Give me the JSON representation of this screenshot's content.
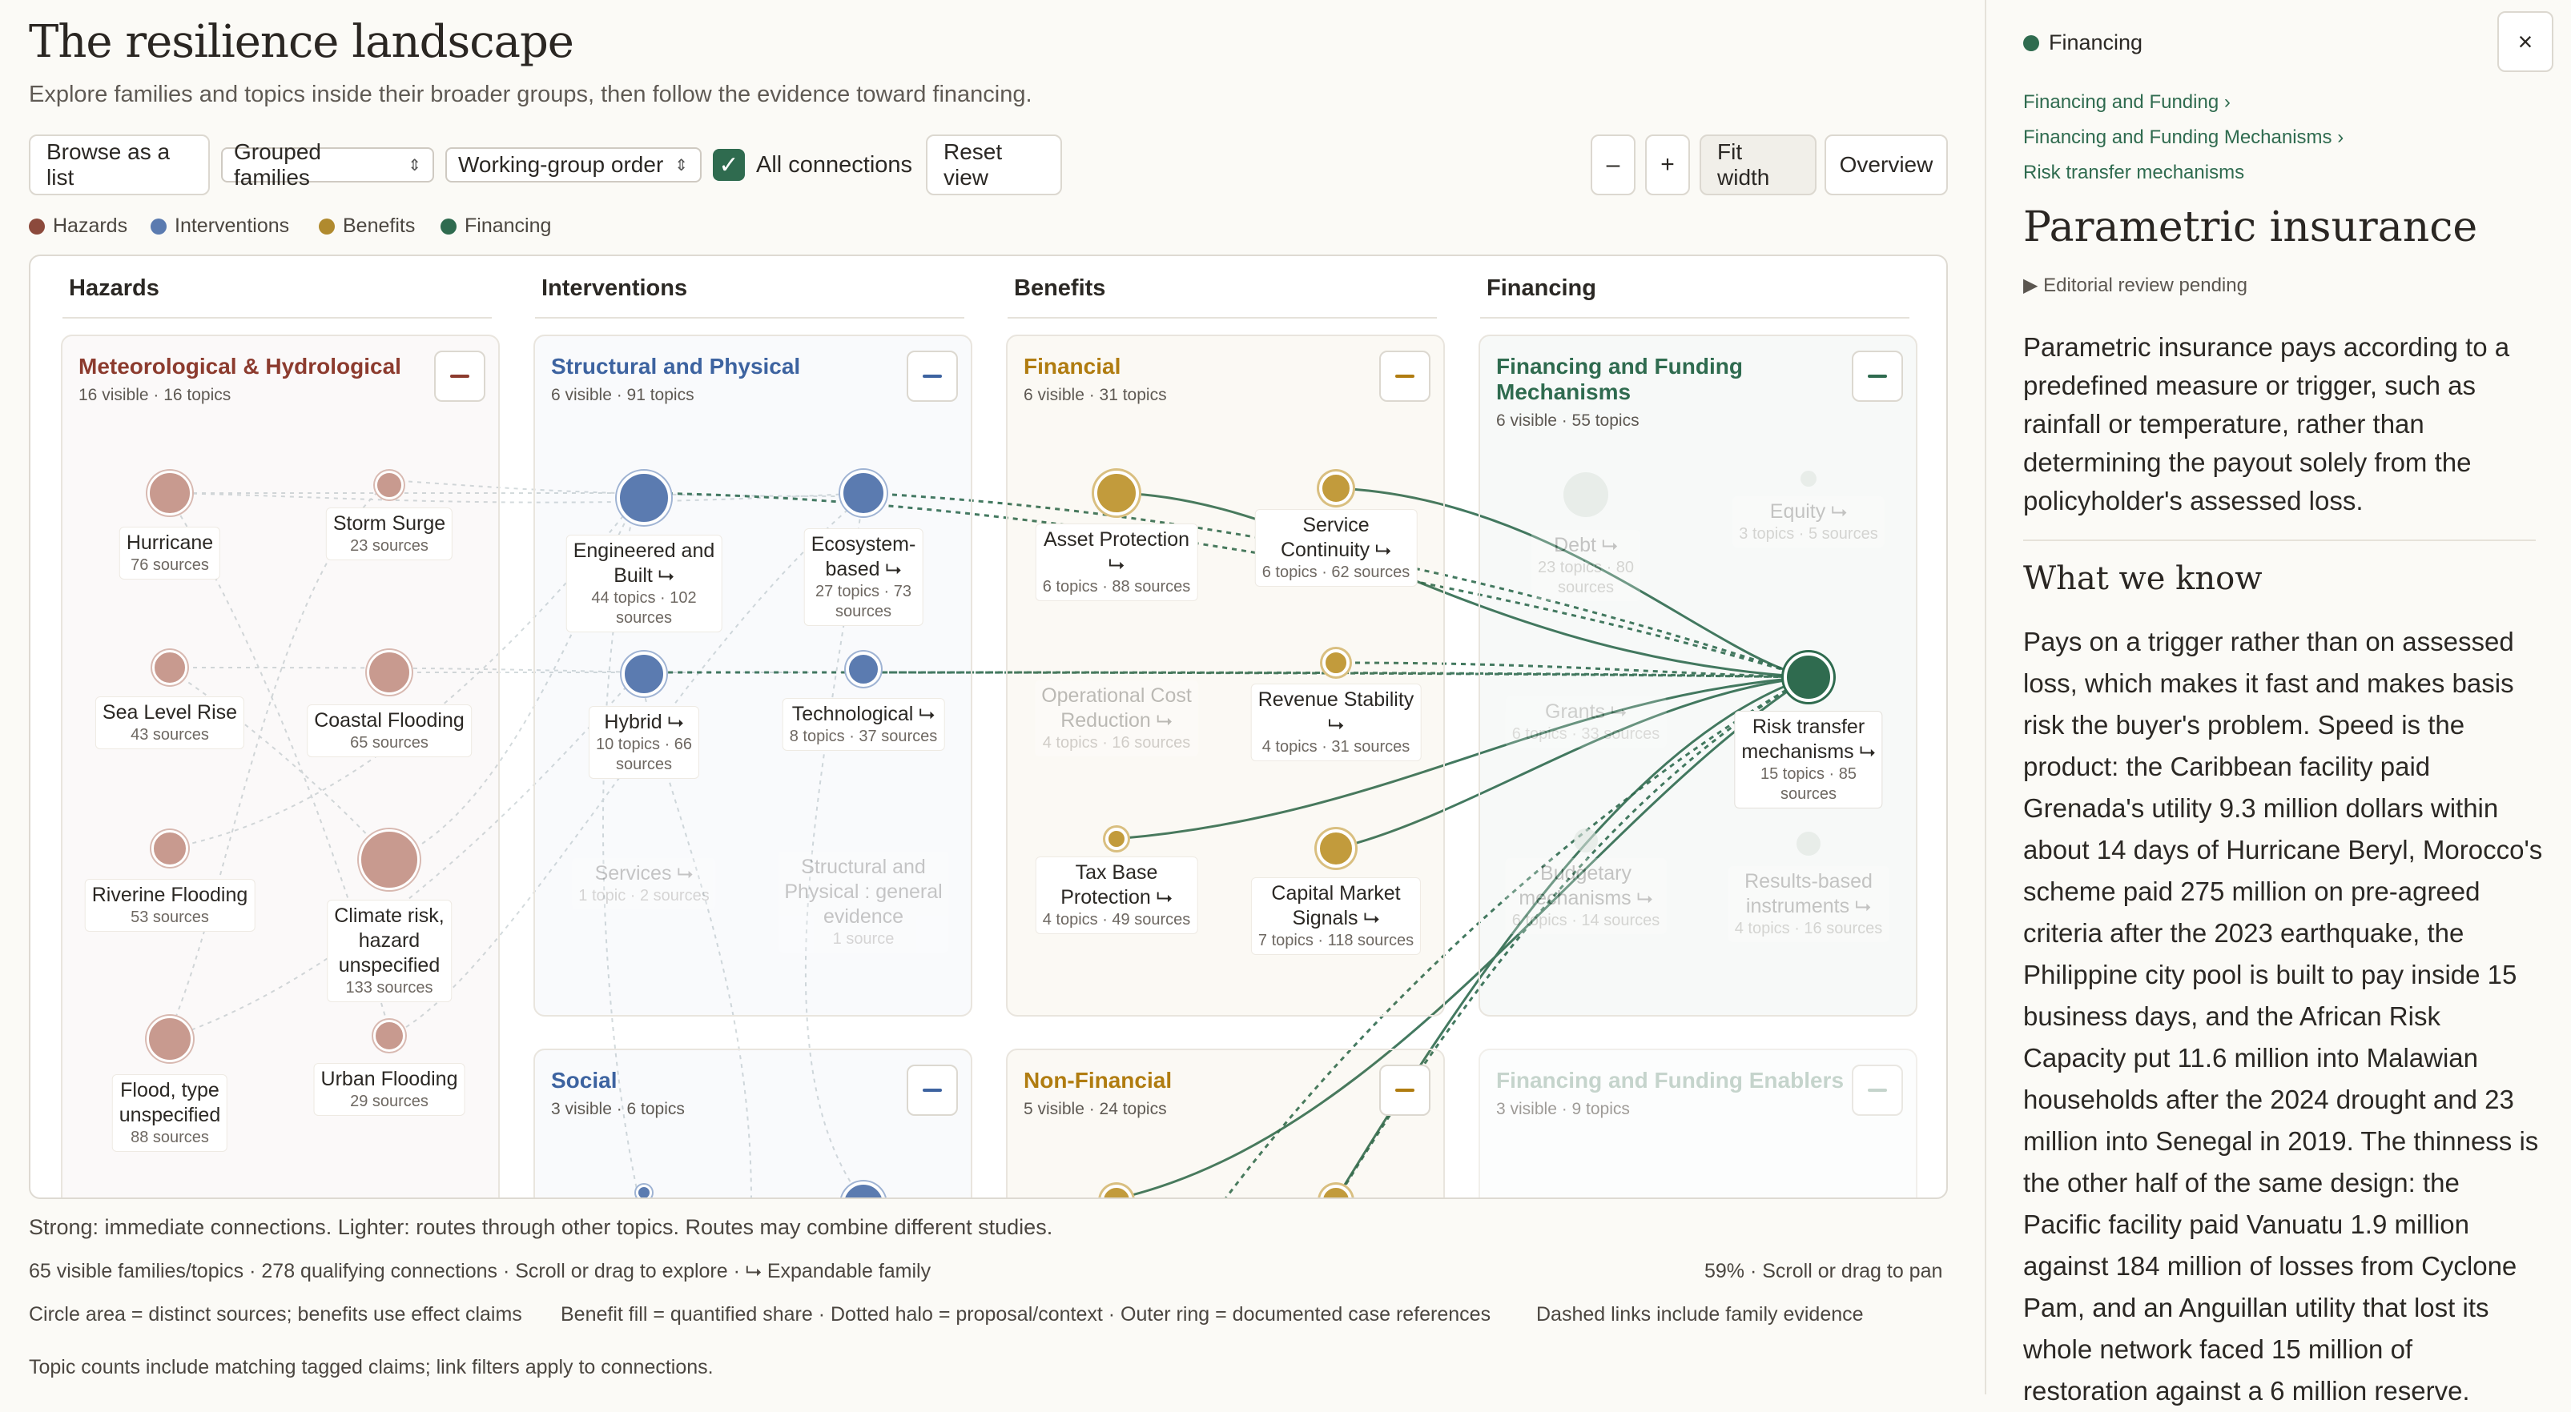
{
  "header": {
    "title": "The resilience landscape",
    "subtitle": "Explore families and topics inside their broader groups, then follow the evidence toward financing."
  },
  "toolbar": {
    "browse_list": "Browse as a list",
    "grouping_select": "Grouped families",
    "order_select": "Working-group order",
    "all_connections_label": "All connections",
    "all_connections_checked": true,
    "reset_view": "Reset view",
    "zoom_out": "–",
    "zoom_in": "+",
    "fit_width": "Fit width",
    "overview": "Overview"
  },
  "legend": [
    {
      "label": "Hazards",
      "color": "#8c4a3c"
    },
    {
      "label": "Interventions",
      "color": "#5b7bb0"
    },
    {
      "label": "Benefits",
      "color": "#b08a2e"
    },
    {
      "label": "Financing",
      "color": "#2f6b4f"
    }
  ],
  "columns": [
    "Hazards",
    "Interventions",
    "Benefits",
    "Financing"
  ],
  "families": [
    {
      "title": "Meteorological & Hydrological",
      "sub": "16 visible · 16 topics",
      "color": "#8c3b2e"
    },
    {
      "title": "Structural and Physical",
      "sub": "6 visible · 91 topics",
      "color": "#3d63a0"
    },
    {
      "title": "Financial",
      "sub": "6 visible · 31 topics",
      "color": "#b07c10"
    },
    {
      "title": "Financing and Funding Mechanisms",
      "sub": "6 visible · 55 topics",
      "color": "#2f6b4f"
    },
    {
      "title": "Social",
      "sub": "3 visible · 6 topics",
      "color": "#3d63a0"
    },
    {
      "title": "Non-Financial",
      "sub": "5 visible · 24 topics",
      "color": "#b07c10"
    },
    {
      "title": "Financing and Funding Enablers",
      "sub": "3 visible · 9 topics",
      "color": "#9fb8ab"
    }
  ],
  "nodes": {
    "hurricane": {
      "label": "Hurricane",
      "sub": "76 sources"
    },
    "storm_surge": {
      "label": "Storm Surge",
      "sub": "23 sources"
    },
    "sea_level": {
      "label": "Sea Level Rise",
      "sub": "43 sources"
    },
    "coastal": {
      "label": "Coastal Flooding",
      "sub": "65 sources"
    },
    "riverine": {
      "label": "Riverine Flooding",
      "sub": "53 sources"
    },
    "climate_risk": {
      "l1": "Climate risk,",
      "l2": "hazard",
      "l3": "unspecified",
      "sub": "133 sources"
    },
    "flood": {
      "l1": "Flood, type",
      "l2": "unspecified",
      "sub": "88 sources"
    },
    "urban": {
      "label": "Urban Flooding",
      "sub": "29 sources"
    },
    "engineered": {
      "l1": "Engineered and",
      "l2": "Built ⮡",
      "sub1": "44 topics · 102",
      "sub2": "sources"
    },
    "ecosystem": {
      "l1": "Ecosystem-",
      "l2": "based ⮡",
      "sub1": "27 topics · 73",
      "sub2": "sources"
    },
    "hybrid": {
      "label": "Hybrid ⮡",
      "sub1": "10 topics · 66",
      "sub2": "sources"
    },
    "technological": {
      "label": "Technological ⮡",
      "sub": "8 topics · 37 sources"
    },
    "services": {
      "label": "Services ⮡",
      "sub": "1 topic · 2 sources"
    },
    "structural_general": {
      "l1": "Structural and",
      "l2": "Physical : general",
      "l3": "evidence",
      "sub": "1 source"
    },
    "asset_protection": {
      "label": "Asset Protection",
      "l2": "⮡",
      "sub": "6 topics · 88 sources"
    },
    "service_continuity": {
      "l1": "Service",
      "l2": "Continuity ⮡",
      "sub": "6 topics · 62 sources"
    },
    "op_cost": {
      "l1": "Operational Cost",
      "l2": "Reduction ⮡",
      "sub": "4 topics · 16 sources"
    },
    "revenue": {
      "label": "Revenue Stability",
      "l2": "⮡",
      "sub": "4 topics · 31 sources"
    },
    "tax_base": {
      "l1": "Tax Base",
      "l2": "Protection ⮡",
      "sub": "4 topics · 49 sources"
    },
    "capital_market": {
      "l1": "Capital Market",
      "l2": "Signals ⮡",
      "sub": "7 topics · 118 sources"
    },
    "debt": {
      "label": "Debt ⮡",
      "sub1": "23 topics · 80",
      "sub2": "sources"
    },
    "equity": {
      "label": "Equity ⮡",
      "sub": "3 topics · 5 sources"
    },
    "grants": {
      "label": "Grants ⮡",
      "sub": "6 topics · 33 sources"
    },
    "risk_transfer": {
      "l1": "Risk transfer",
      "l2": "mechanisms ⮡",
      "sub1": "15 topics · 85",
      "sub2": "sources"
    },
    "budgetary": {
      "l1": "Budgetary",
      "l2": "mechanisms ⮡",
      "sub": "6 topics · 14 sources"
    },
    "results_based": {
      "l1": "Results-based",
      "l2": "instruments ⮡",
      "sub": "4 topics · 16 sources"
    }
  },
  "footer": {
    "line1": "Strong: immediate connections. Lighter: routes through other topics. Routes may combine different studies.",
    "line2": "65 visible families/topics · 278 qualifying connections · Scroll or drag to explore · ⮡ Expandable family",
    "zoom": "59% · Scroll or drag to pan",
    "line3a": "Circle area = distinct sources; benefits use effect claims",
    "line3b": "Benefit fill = quantified share · Dotted halo = proposal/context · Outer ring = documented case references",
    "line3c": "Dashed links include family evidence",
    "line4": "Topic counts include matching tagged claims; link filters apply to connections."
  },
  "panel": {
    "category": "Financing",
    "close": "×",
    "crumb1": "Financing and Funding ›",
    "crumb2": "Financing and Funding Mechanisms ›",
    "crumb3": "Risk transfer mechanisms",
    "title": "Parametric insurance",
    "review": "▶ Editorial review pending",
    "description": "Parametric insurance pays according to a predefined measure or trigger, such as rainfall or temperature, rather than determining the payout solely from the policyholder's assessed loss.",
    "know_heading": "What we know",
    "know_text": "Pays on a trigger rather than on assessed loss, which makes it fast and makes basis risk the buyer's problem. Speed is the product: the Caribbean facility paid Grenada's utility 9.3 million dollars within about 14 days of Hurricane Beryl, Morocco's scheme paid 275 million on pre-agreed criteria after the 2023 earthquake, the Philippine city pool is built to pay inside 15 business days, and the African Risk Capacity put 11.6 million into Malawian households after the 2024 drought and 23 million into Senegal in 2019. The thinness is the other half of the same design: the Pacific facility paid Vanuatu 1.9 million against 184 million of losses from Cyclone Pam, and an Anguillan utility that lost its whole network faced 15 million of restoration against a 6 million reserve."
  }
}
